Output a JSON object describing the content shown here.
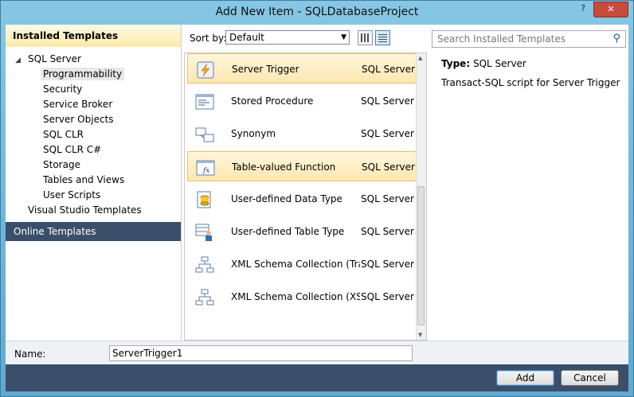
{
  "window": {
    "title": "Add New Item - SQLDatabaseProject",
    "help_label": "?",
    "close_label": "✕"
  },
  "sidebar": {
    "header": "Installed Templates",
    "tree": [
      {
        "label": "SQL Server",
        "level": 0,
        "expanded": true
      },
      {
        "label": "Programmability",
        "level": 1,
        "selected": true
      },
      {
        "label": "Security",
        "level": 1
      },
      {
        "label": "Service Broker",
        "level": 1
      },
      {
        "label": "Server Objects",
        "level": 1
      },
      {
        "label": "SQL CLR",
        "level": 1
      },
      {
        "label": "SQL CLR C#",
        "level": 1
      },
      {
        "label": "Storage",
        "level": 1
      },
      {
        "label": "Tables and Views",
        "level": 1
      },
      {
        "label": "User Scripts",
        "level": 1
      },
      {
        "label": "Visual Studio Templates",
        "level": 0
      }
    ],
    "online": "Online Templates"
  },
  "sort": {
    "label": "Sort by:",
    "value": "Default"
  },
  "templates": [
    {
      "name": "Server Trigger",
      "type": "SQL Server",
      "icon": "lightning-script-icon",
      "selected": true
    },
    {
      "name": "Stored Procedure",
      "type": "SQL Server",
      "icon": "procedure-icon"
    },
    {
      "name": "Synonym",
      "type": "SQL Server",
      "icon": "synonym-icon"
    },
    {
      "name": "Table-valued Function",
      "type": "SQL Server",
      "icon": "function-icon",
      "hover": true
    },
    {
      "name": "User-defined Data Type",
      "type": "SQL Server",
      "icon": "data-type-icon"
    },
    {
      "name": "User-defined Table Type",
      "type": "SQL Server",
      "icon": "table-type-icon"
    },
    {
      "name": "XML Schema Collection (Tra...",
      "type": "SQL Server",
      "icon": "xml-schema-icon"
    },
    {
      "name": "XML Schema Collection (XSD)",
      "type": "SQL Server",
      "icon": "xml-schema-icon"
    }
  ],
  "search": {
    "placeholder": "Search Installed Templates"
  },
  "details": {
    "type_label": "Type:",
    "type_value": "SQL Server",
    "description": "Transact-SQL script for Server Trigger"
  },
  "name_field": {
    "label": "Name:",
    "value": "ServerTrigger1"
  },
  "buttons": {
    "add": "Add",
    "cancel": "Cancel"
  }
}
